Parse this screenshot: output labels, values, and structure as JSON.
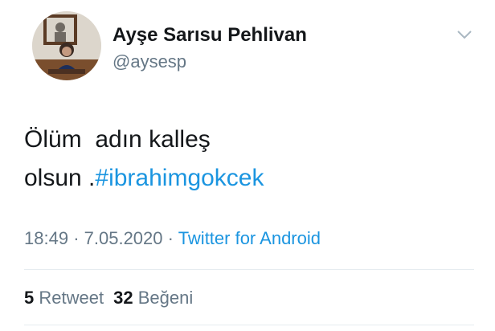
{
  "author": {
    "display_name": "Ayşe Sarısu Pehlivan",
    "username": "@aysesp"
  },
  "tweet": {
    "text_line1": "Ölüm  adın kalleş",
    "text_line2_prefix": "olsun .",
    "hashtag": "#ibrahimgokcek"
  },
  "meta": {
    "time": "18:49",
    "separator": "·",
    "date": "7.05.2020",
    "source": "Twitter for Android"
  },
  "stats": {
    "retweet_count": "5",
    "retweet_label": "Retweet",
    "like_count": "32",
    "like_label": "Beğeni"
  },
  "icons": {
    "menu": "chevron-down-icon"
  },
  "colors": {
    "link": "#1b95e0",
    "secondary_text": "#657786",
    "primary_text": "#14171a",
    "divider": "#e6ecf0"
  }
}
